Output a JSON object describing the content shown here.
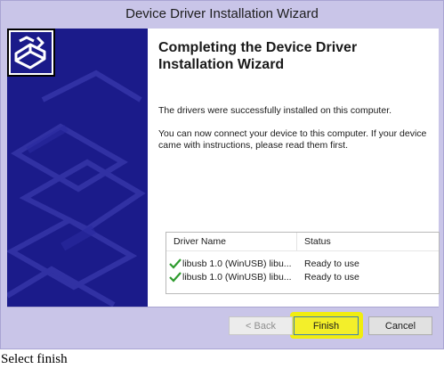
{
  "window": {
    "title": "Device Driver Installation Wizard"
  },
  "wizard": {
    "heading": "Completing the Device Driver Installation Wizard",
    "message1": "The drivers were successfully installed on this computer.",
    "message2": "You can now connect your device to this computer. If your device came with instructions, please read them first."
  },
  "driver_list": {
    "columns": [
      "Driver Name",
      "Status"
    ],
    "rows": [
      {
        "name": "libusb 1.0 (WinUSB) libu...",
        "status": "Ready to use",
        "icon": "green-check-icon"
      },
      {
        "name": "libusb 1.0 (WinUSB) libu...",
        "status": "Ready to use",
        "icon": "green-check-icon"
      }
    ]
  },
  "buttons": {
    "back": "< Back",
    "finish": "Finish",
    "cancel": "Cancel"
  },
  "caption": "Select finish",
  "colors": {
    "sidebar": "#1b1b8a",
    "chrome": "#c9c5e8",
    "highlight": "#f1ed10",
    "check": "#2e9b2e"
  },
  "icons": {
    "wizard": "hardware-install-icon"
  }
}
